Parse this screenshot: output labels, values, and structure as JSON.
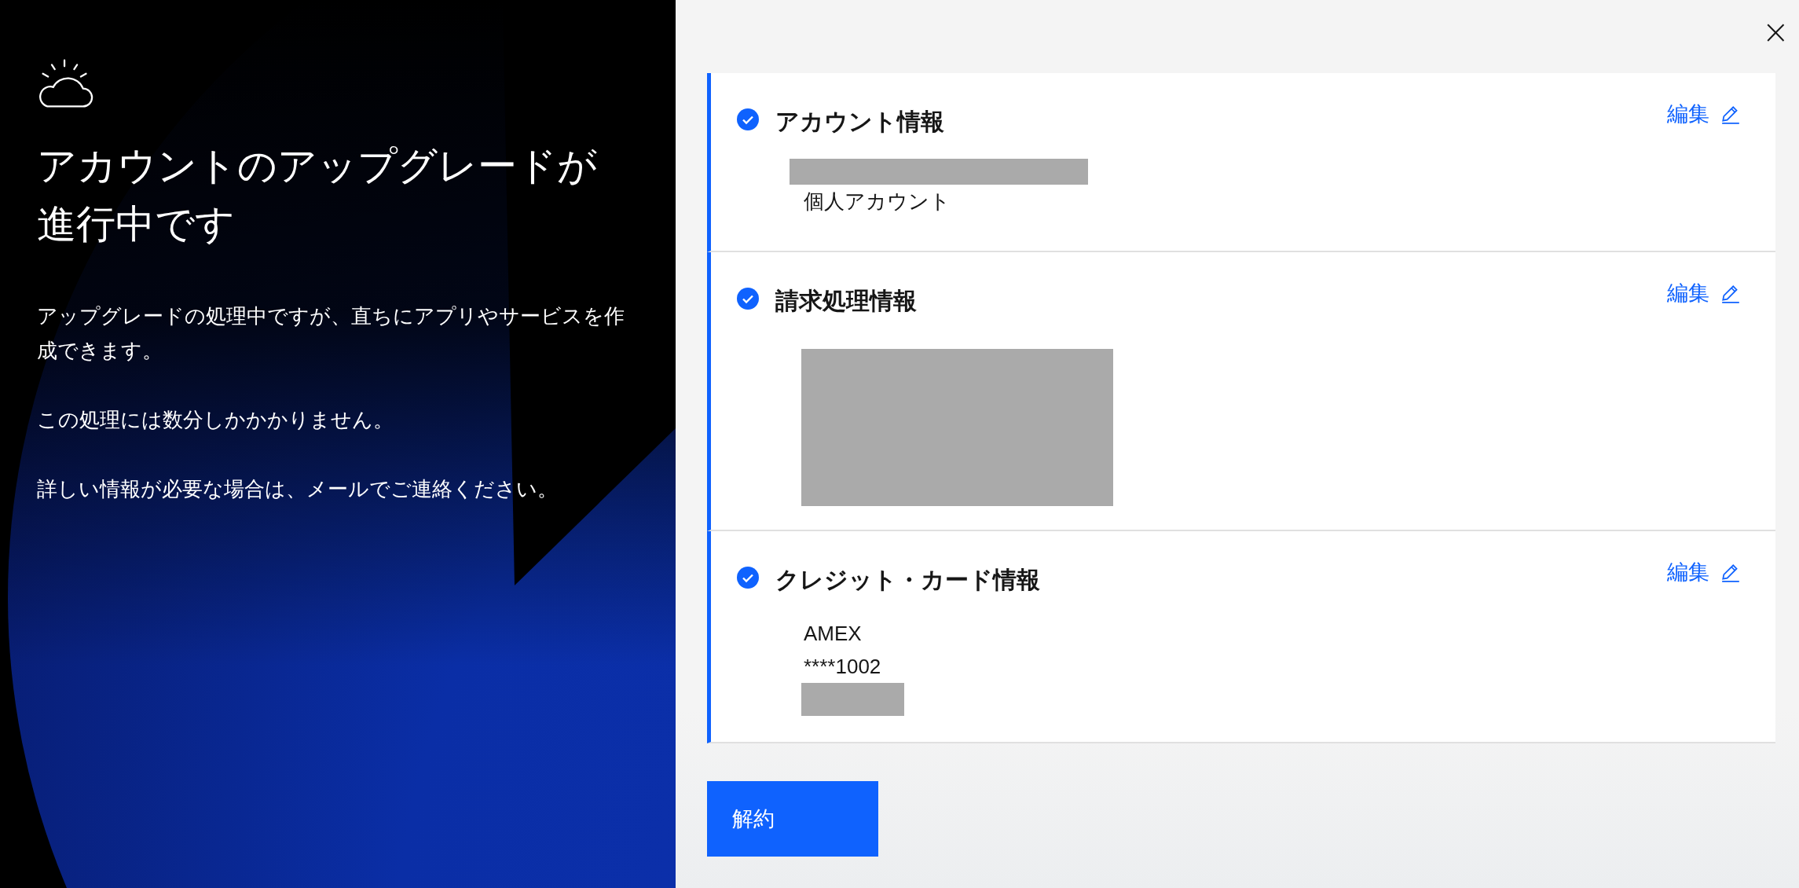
{
  "left_panel": {
    "title": "アカウントのアップグレードが進行中です",
    "paragraphs": [
      "アップグレードの処理中ですが、直ちにアプリやサービスを作成できます。",
      "この処理には数分しかかかりません。",
      "詳しい情報が必要な場合は、メールでご連絡ください。"
    ]
  },
  "close_button": {
    "label": "×"
  },
  "sections": [
    {
      "title": "アカウント情報",
      "completed": true,
      "edit_label": "編集",
      "lines": [
        {
          "kind": "redacted"
        },
        {
          "kind": "text",
          "text": "個人アカウント"
        }
      ]
    },
    {
      "title": "請求処理情報",
      "completed": true,
      "edit_label": "編集",
      "lines": [
        {
          "kind": "redacted"
        }
      ]
    },
    {
      "title": "クレジット・カード情報",
      "completed": true,
      "edit_label": "編集",
      "lines": [
        {
          "kind": "text",
          "text": "AMEX"
        },
        {
          "kind": "text",
          "text": "****1002"
        },
        {
          "kind": "redacted"
        }
      ]
    }
  ],
  "primary_button": {
    "label": "解約"
  }
}
